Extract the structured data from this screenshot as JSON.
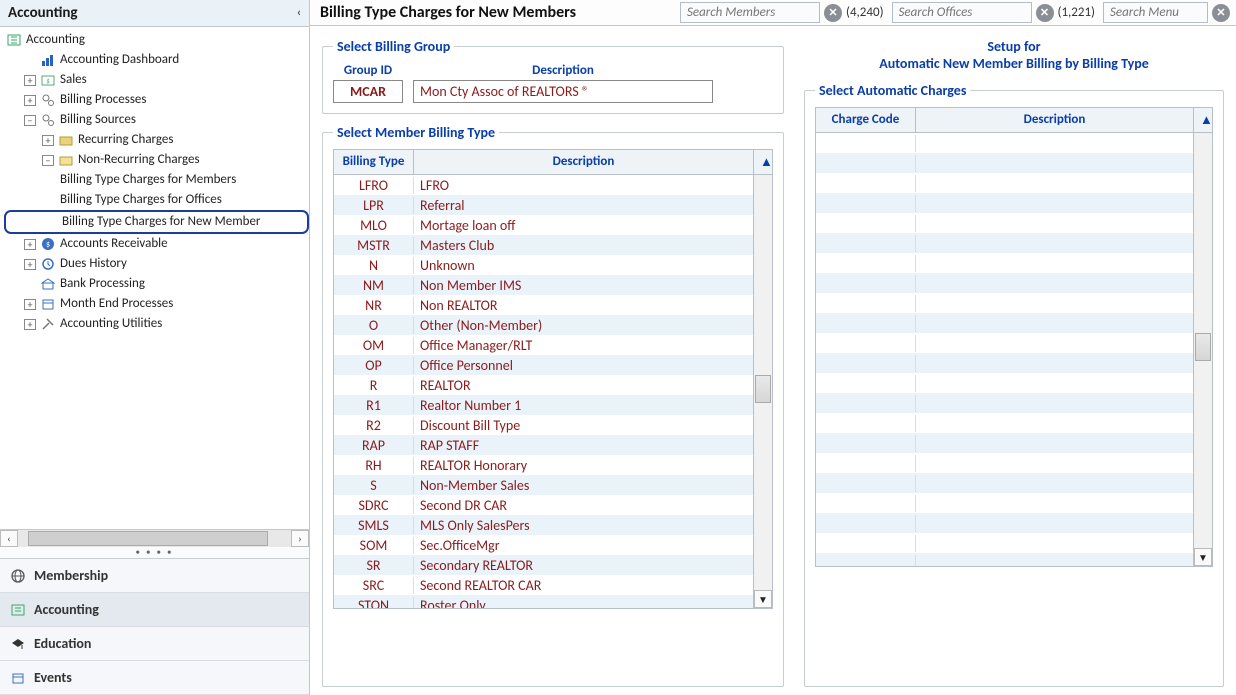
{
  "sidebar_title": "Accounting",
  "tree_root_label": "Accounting",
  "tree": {
    "dashboard": "Accounting Dashboard",
    "sales": "Sales",
    "billing_processes": "Billing Processes",
    "billing_sources": "Billing Sources",
    "recurring_charges": "Recurring Charges",
    "non_recurring_charges": "Non-Recurring Charges",
    "btc_members": "Billing Type Charges for Members",
    "btc_offices": "Billing Type Charges for Offices",
    "btc_new_member": "Billing Type Charges for New Member",
    "accounts_receivable": "Accounts Receivable",
    "dues_history": "Dues History",
    "bank_processing": "Bank Processing",
    "month_end": "Month End Processes",
    "utilities": "Accounting Utilities"
  },
  "sidenav": {
    "membership": "Membership",
    "accounting": "Accounting",
    "education": "Education",
    "events": "Events"
  },
  "page_title": "Billing Type Charges for New Members",
  "search": {
    "members_ph": "Search Members",
    "members_count": "(4,240)",
    "offices_ph": "Search Offices",
    "offices_count": "(1,221)",
    "menu_ph": "Search Menu"
  },
  "billing_group": {
    "legend": "Select Billing Group",
    "group_id_label": "Group ID",
    "description_label": "Description",
    "group_id": "MCAR",
    "description": "Mon Cty Assoc of REALTORS ®"
  },
  "setup_for_line1": "Setup for",
  "setup_for_line2": "Automatic New Member Billing by Billing Type",
  "member_table": {
    "legend": "Select Member Billing Type",
    "col_type": "Billing Type",
    "col_desc": "Description",
    "rows": [
      {
        "t": "LFRO",
        "d": "LFRO"
      },
      {
        "t": "LPR",
        "d": "Referral"
      },
      {
        "t": "MLO",
        "d": "Mortage loan off"
      },
      {
        "t": "MSTR",
        "d": "Masters Club"
      },
      {
        "t": "N",
        "d": "Unknown"
      },
      {
        "t": "NM",
        "d": "Non Member IMS"
      },
      {
        "t": "NR",
        "d": "Non REALTOR"
      },
      {
        "t": "O",
        "d": "Other (Non-Member)"
      },
      {
        "t": "OM",
        "d": "Office Manager/RLT"
      },
      {
        "t": "OP",
        "d": "Office Personnel"
      },
      {
        "t": "R",
        "d": "REALTOR"
      },
      {
        "t": "R1",
        "d": "Realtor Number 1"
      },
      {
        "t": "R2",
        "d": "Discount Bill Type"
      },
      {
        "t": "RAP",
        "d": "RAP STAFF"
      },
      {
        "t": "RH",
        "d": "REALTOR Honorary"
      },
      {
        "t": "S",
        "d": "Non-Member Sales"
      },
      {
        "t": "SDRC",
        "d": "Second DR CAR"
      },
      {
        "t": "SMLS",
        "d": "MLS Only SalesPers"
      },
      {
        "t": "SOM",
        "d": "Sec.OfficeMgr"
      },
      {
        "t": "SR",
        "d": "Secondary REALTOR"
      },
      {
        "t": "SRC",
        "d": "Second REALTOR CAR"
      },
      {
        "t": "STON",
        "d": "Roster Only"
      }
    ]
  },
  "charges_table": {
    "legend": "Select Automatic Charges",
    "col_code": "Charge Code",
    "col_desc": "Description",
    "empty_rows": 22
  }
}
